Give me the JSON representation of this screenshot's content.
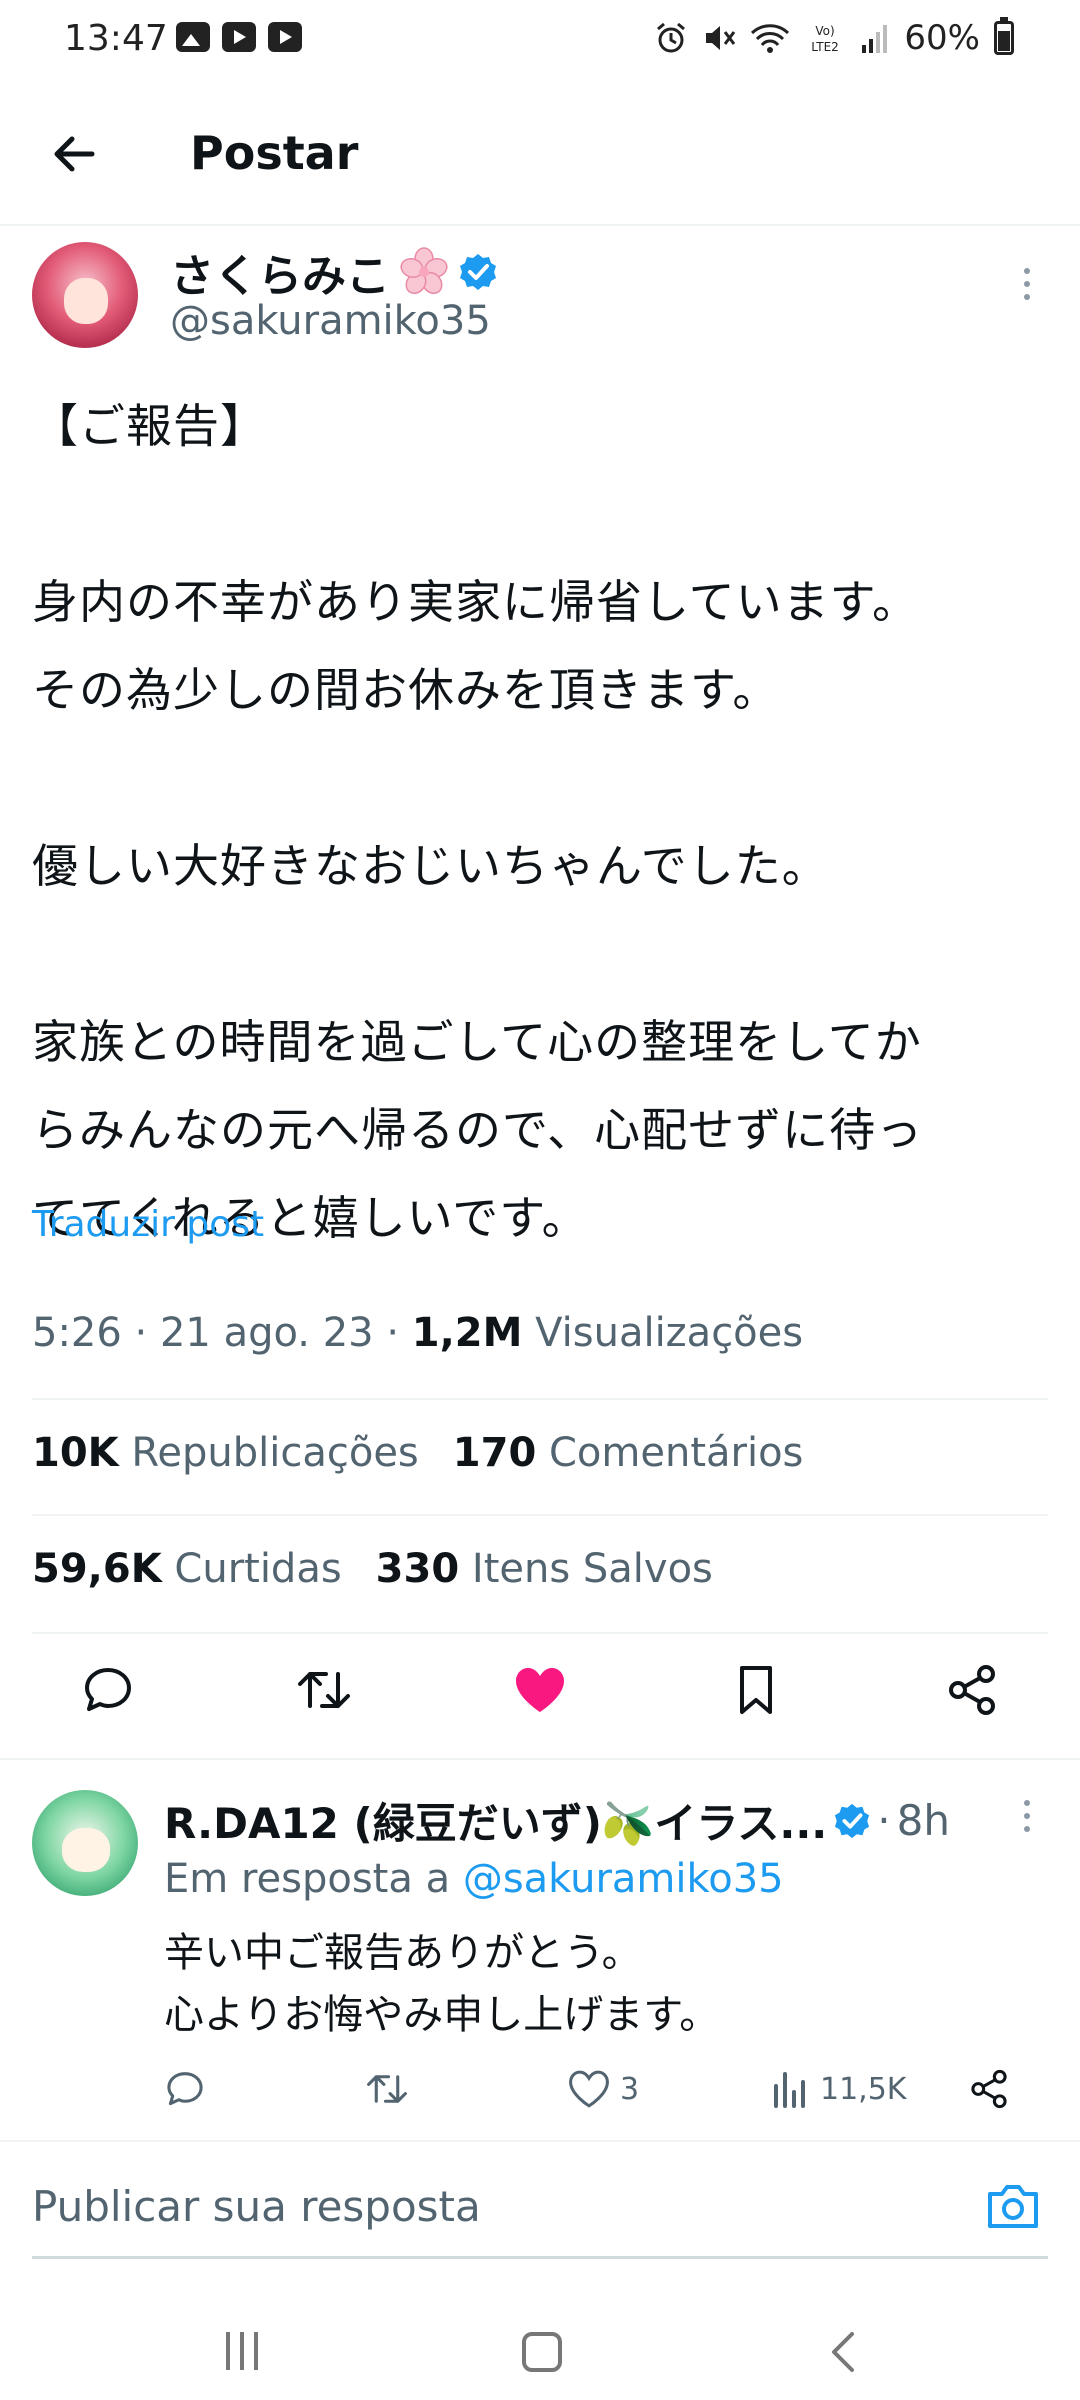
{
  "status_bar": {
    "time": "13:47",
    "battery": "60%"
  },
  "header": {
    "title": "Postar"
  },
  "post": {
    "author_name": "さくらみこ",
    "handle": "@sakuramiko35",
    "body": "【ご報告】\n\n身内の不幸があり実家に帰省しています。\nその為少しの間お休みを頂きます。\n\n優しい大好きなおじいちゃんでした。\n\n家族との時間を過ごして心の整理をしてか\nらみんなの元へ帰るので、心配せずに待っ\nててくれると嬉しいです。",
    "translate_label": "Traduzir post",
    "time": "5:26",
    "date": "21 ago. 23",
    "views_count": "1,2M",
    "views_label": "Visualizações",
    "reposts_count": "10K",
    "reposts_label": "Republicações",
    "comments_count": "170",
    "comments_label": "Comentários",
    "likes_count": "59,6K",
    "likes_label": "Curtidas",
    "saves_count": "330",
    "saves_label": "Itens Salvos",
    "liked": true,
    "accent_color": "#1d9bf0",
    "like_color": "#f91880"
  },
  "reply": {
    "author_name": "R.DA12 (緑豆だいず)🫒イラス...",
    "time": "8h",
    "reply_to_prefix": "Em resposta a",
    "reply_to_handle": "@sakuramiko35",
    "body": "辛い中ご報告ありがとう。\n心よりお悔やみ申し上げます。",
    "likes": "3",
    "views": "11,5K"
  },
  "compose": {
    "placeholder": "Publicar sua resposta"
  },
  "icons": {
    "status_left": [
      "gallery-icon",
      "youtube-icon",
      "youtube-icon"
    ],
    "status_right": [
      "alarm-icon",
      "mute-icon",
      "wifi-icon",
      "volte-icon",
      "signal-icon",
      "battery-icon"
    ],
    "actions": [
      "comment-icon",
      "repost-icon",
      "heart-icon",
      "bookmark-icon",
      "share-icon"
    ],
    "nav": [
      "recent-apps-icon",
      "home-icon",
      "back-icon"
    ]
  }
}
